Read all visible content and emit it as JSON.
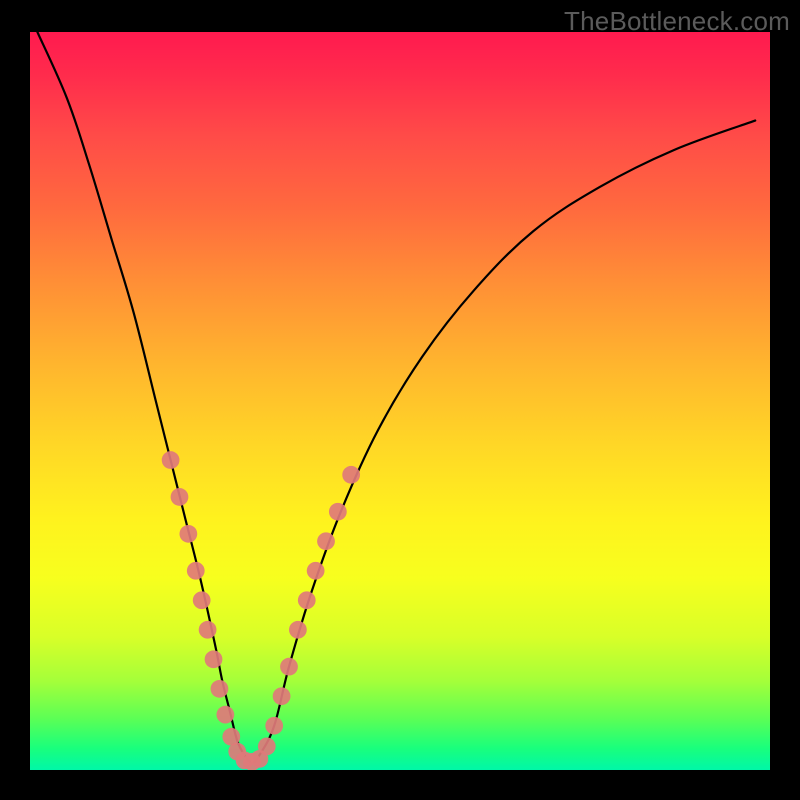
{
  "watermark": "TheBottleneck.com",
  "chart_data": {
    "type": "line",
    "title": "",
    "xlabel": "",
    "ylabel": "",
    "xlim": [
      0,
      100
    ],
    "ylim": [
      0,
      100
    ],
    "grid": false,
    "series": [
      {
        "name": "bottleneck-curve",
        "color": "#000000",
        "x": [
          1,
          5,
          8,
          11,
          14,
          17,
          19,
          21,
          23,
          25,
          26,
          27,
          28,
          29,
          30,
          31,
          33,
          35,
          38,
          42,
          47,
          53,
          60,
          68,
          77,
          87,
          98
        ],
        "y": [
          100,
          91,
          82,
          72,
          62,
          50,
          42,
          34,
          26,
          17,
          12,
          8,
          4,
          2,
          1,
          2,
          6,
          14,
          24,
          35,
          46,
          56,
          65,
          73,
          79,
          84,
          88
        ]
      }
    ],
    "markers": {
      "name": "highlight-markers",
      "color": "#e07a7a",
      "radius_pct": 1.2,
      "points": [
        {
          "x": 19,
          "y": 42
        },
        {
          "x": 20.2,
          "y": 37
        },
        {
          "x": 21.4,
          "y": 32
        },
        {
          "x": 22.4,
          "y": 27
        },
        {
          "x": 23.2,
          "y": 23
        },
        {
          "x": 24,
          "y": 19
        },
        {
          "x": 24.8,
          "y": 15
        },
        {
          "x": 25.6,
          "y": 11
        },
        {
          "x": 26.4,
          "y": 7.5
        },
        {
          "x": 27.2,
          "y": 4.5
        },
        {
          "x": 28,
          "y": 2.5
        },
        {
          "x": 29,
          "y": 1.3
        },
        {
          "x": 30,
          "y": 1.1
        },
        {
          "x": 31,
          "y": 1.5
        },
        {
          "x": 32,
          "y": 3.2
        },
        {
          "x": 33,
          "y": 6
        },
        {
          "x": 34,
          "y": 10
        },
        {
          "x": 35,
          "y": 14
        },
        {
          "x": 36.2,
          "y": 19
        },
        {
          "x": 37.4,
          "y": 23
        },
        {
          "x": 38.6,
          "y": 27
        },
        {
          "x": 40,
          "y": 31
        },
        {
          "x": 41.6,
          "y": 35
        },
        {
          "x": 43.4,
          "y": 40
        }
      ]
    },
    "gradient_stops": [
      {
        "pos": 0,
        "color": "#ff1a4f"
      },
      {
        "pos": 14,
        "color": "#ff4b48"
      },
      {
        "pos": 34,
        "color": "#ff8f36"
      },
      {
        "pos": 56,
        "color": "#ffd726"
      },
      {
        "pos": 74,
        "color": "#f7ff1e"
      },
      {
        "pos": 93,
        "color": "#5cff55"
      },
      {
        "pos": 100,
        "color": "#00f7a8"
      }
    ]
  }
}
